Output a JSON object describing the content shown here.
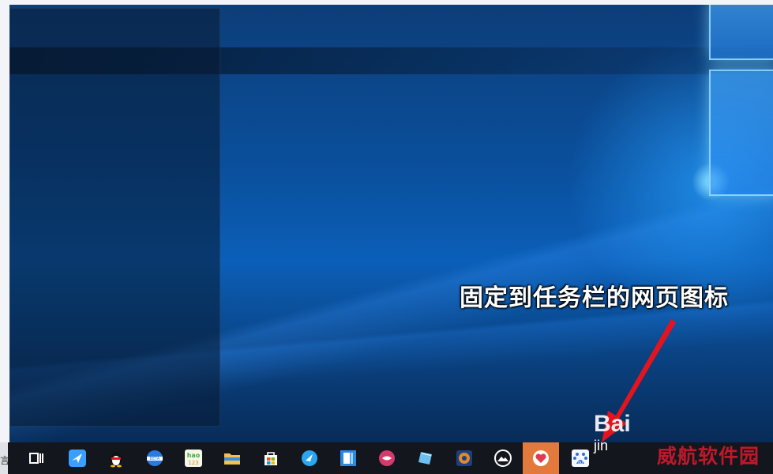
{
  "desktop": {
    "annotation_text": "固定到任务栏的网页图标"
  },
  "watermark": {
    "baidu_big": "Bai",
    "baidu_small": "jin",
    "site_name": "威航软件园"
  },
  "taskbar": {
    "left_edge_char": "言",
    "icons": [
      {
        "name": "task-view-icon",
        "color": "#ffffff"
      },
      {
        "name": "feishu-bird-icon",
        "color": "#3aa0ff"
      },
      {
        "name": "qq-penguin-icon",
        "color": "#ffffff"
      },
      {
        "name": "ie-beta-browser-icon",
        "color": "#2a7be0"
      },
      {
        "name": "hao123-icon",
        "color": "#43a93c"
      },
      {
        "name": "file-explorer-icon",
        "color": "#f2c14e"
      },
      {
        "name": "microsoft-store-icon",
        "color": "#ffffff"
      },
      {
        "name": "edge-browser-icon",
        "color": "#2aa6f0"
      },
      {
        "name": "onedrive-app-icon",
        "color": "#2a8ae0"
      },
      {
        "name": "pink-lips-app-icon",
        "color": "#d63a6a"
      },
      {
        "name": "notes-app-icon",
        "color": "#6bc0f0"
      },
      {
        "name": "media-player-icon",
        "color": "#e08a2a"
      },
      {
        "name": "photos-app-icon",
        "color": "#ffffff"
      },
      {
        "name": "heart-app-icon",
        "color": "#e23b4a"
      },
      {
        "name": "baidu-paw-icon",
        "color": "#2a6fe0"
      }
    ]
  }
}
